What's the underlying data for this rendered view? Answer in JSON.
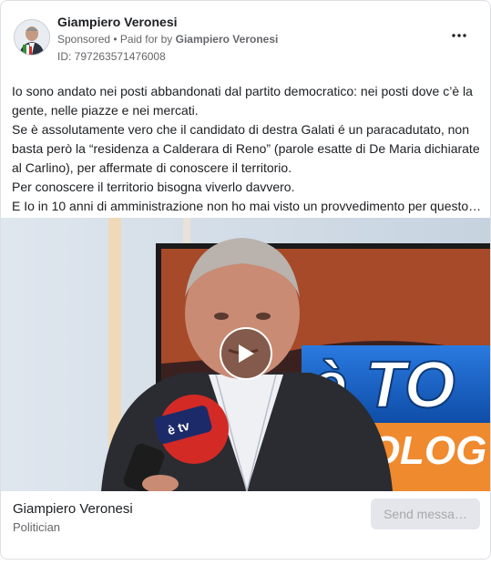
{
  "post": {
    "page_name": "Giampiero Veronesi",
    "sponsored_label": "Sponsored",
    "separator": " • ",
    "paid_prefix": "Paid for by ",
    "paid_by": "Giampiero Veronesi",
    "ad_id": "ID: 797263571476008",
    "more_icon": "more-horizontal-icon"
  },
  "body": {
    "lines": [
      "Io sono andato nei posti abbandonati dal partito democratico: nei posti dove c’è la",
      "gente, nelle piazze e nei mercati.",
      "Se è assolutamente vero che il candidato di destra Galati é un paracadutato, non",
      "basta però la “residenza a Calderara di Reno” (parole esatte di De Maria dichiarate",
      "al Carlino), per affermate di conoscere il territorio.",
      "Per conoscere il territorio bisogna viverlo davvero.",
      "E Io in 10 anni di amministrazione non ho mai visto un provvedimento per questo…"
    ]
  },
  "media": {
    "backdrop_text_1": "è TO",
    "backdrop_text_2": "BOLOG",
    "mic_text": "è tv",
    "play_icon": "play-icon"
  },
  "footer": {
    "name": "Giampiero Veronesi",
    "role": "Politician",
    "cta_label": "Send messa…"
  },
  "colors": {
    "text": "#1c1e21",
    "secondary": "#65676b",
    "cta_bg": "#e4e6eb",
    "cta_text": "#a6a8ab",
    "backdrop_orange": "#ef8a2e",
    "backdrop_blue": "#1760c8"
  }
}
